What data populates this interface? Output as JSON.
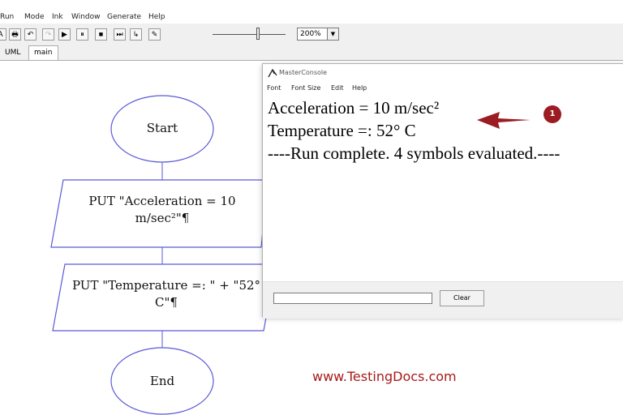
{
  "menubar": {
    "items": [
      "Run",
      "Mode",
      "Ink",
      "Window",
      "Generate",
      "Help"
    ]
  },
  "toolbar": {
    "buttons": [
      {
        "icon": "save-icon",
        "glyph": "A"
      },
      {
        "icon": "print-icon",
        "glyph": "🖶"
      },
      {
        "icon": "undo-icon",
        "glyph": "↶"
      },
      {
        "icon": "redo-icon",
        "glyph": "↷"
      },
      {
        "icon": "run-icon",
        "glyph": "▶"
      },
      {
        "icon": "pause-icon",
        "glyph": "⏸"
      },
      {
        "icon": "stop-icon",
        "glyph": "■"
      },
      {
        "icon": "step-icon",
        "glyph": "⏭"
      },
      {
        "icon": "step-into-icon",
        "glyph": "↳"
      },
      {
        "icon": "pen-icon",
        "glyph": "✎"
      }
    ],
    "zoom": "200%"
  },
  "tabs": [
    {
      "label": "UML"
    },
    {
      "label": "main"
    }
  ],
  "flowchart": {
    "start": "Start",
    "put1_line1": "PUT \"Acceleration = 10",
    "put1_line2": "m/sec²\"¶",
    "put2_line1": "PUT \"Temperature =: \" + \"52°",
    "put2_line2": "C\"¶",
    "end": "End"
  },
  "console": {
    "title": "MasterConsole",
    "menu": [
      "Font",
      "Font Size",
      "Edit",
      "Help"
    ],
    "output": [
      "Acceleration = 10 m/sec²",
      "Temperature =: 52° C",
      "----Run complete.  4 symbols evaluated.----"
    ],
    "input_value": "",
    "clear_label": "Clear"
  },
  "annotation": {
    "badge": "1",
    "color": "#9b1c22"
  },
  "watermark": "www.TestingDocs.com"
}
